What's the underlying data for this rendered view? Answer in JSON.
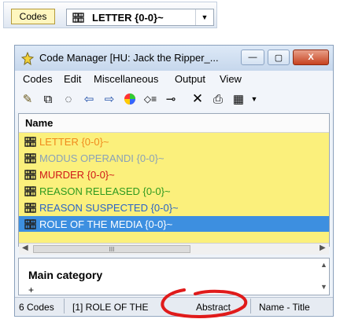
{
  "top_toolbar": {
    "codes_button": "Codes",
    "selected_code": "LETTER {0-0}~"
  },
  "window": {
    "title": "Code Manager [HU: Jack the Ripper_...",
    "controls": [
      "—",
      "▢",
      "X"
    ]
  },
  "menu": [
    "Codes",
    "Edit",
    "Miscellaneous",
    "Output",
    "View"
  ],
  "list": {
    "header": "Name",
    "items": [
      {
        "label": "LETTER {0-0}~",
        "color": "#f08a1c"
      },
      {
        "label": "MODUS OPERANDI {0-0}~",
        "color": "#8aa2b8"
      },
      {
        "label": "MURDER {0-0}~",
        "color": "#d01818"
      },
      {
        "label": "REASON RELEASED {0-0}~",
        "color": "#2e9a1f"
      },
      {
        "label": "REASON SUSPECTED {0-0}~",
        "color": "#2a63c7"
      },
      {
        "label": "ROLE OF THE MEDIA {0-0}~",
        "color": "#ffffff",
        "selected": true
      }
    ],
    "scroll_grip": "III"
  },
  "comment": {
    "title": "Main category",
    "body": "+"
  },
  "status": {
    "count": "6 Codes",
    "selected": "[1] ROLE OF THE",
    "abstract": "Abstract",
    "sort": "Name - Title"
  },
  "colors": {
    "list_bg": "#fbf07c",
    "selection": "#3d8fe0",
    "annotation": "#e01b1b"
  }
}
